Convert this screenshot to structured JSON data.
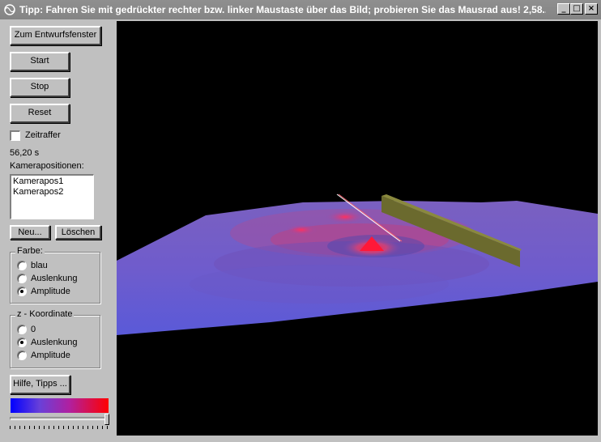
{
  "window": {
    "title": "Tipp: Fahren Sie mit gedrückter rechter bzw. linker Maustaste über das Bild; probieren Sie das Mausrad aus! 2,58...",
    "minimize_glyph": "_",
    "maximize_glyph": "□",
    "close_glyph": "×"
  },
  "controls": {
    "design_window_label": "Zum Entwurfsfenster",
    "start_label": "Start",
    "stop_label": "Stop",
    "reset_label": "Reset",
    "timelapse_label": "Zeitraffer",
    "timelapse_checked": false,
    "time_display": "56,20 s",
    "camera_positions_label": "Kamerapositionen:",
    "camera_positions": [
      "Kamerapos1",
      "Kamerapos2"
    ],
    "new_label": "Neu...",
    "delete_label": "Löschen",
    "help_label": "Hilfe, Tipps ..."
  },
  "color_group": {
    "title": "Farbe:",
    "options": [
      "blau",
      "Auslenkung",
      "Amplitude"
    ],
    "selected": 2
  },
  "z_group": {
    "title": "z - Koordinate",
    "options": [
      "0",
      "Auslenkung",
      "Amplitude"
    ],
    "selected": 1
  },
  "colors": {
    "window_bg": "#c0c0c0",
    "viewport_bg": "#000000",
    "surface_low": "#5a5ad0",
    "surface_high": "#ff3050",
    "wall": "#6b6a2e"
  },
  "colorbar": {
    "colors": [
      "#0000ff",
      "#ff0000"
    ]
  },
  "slider": {
    "value_fraction": 1.0
  }
}
